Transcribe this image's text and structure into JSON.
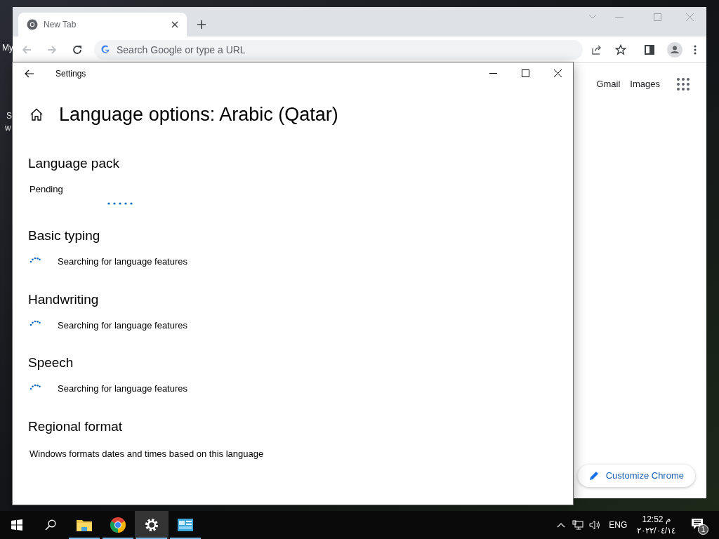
{
  "desktop_labels": [
    "My",
    "S",
    "w"
  ],
  "browser": {
    "tab": {
      "title": "New Tab",
      "selected": true
    },
    "address_placeholder": "Search Google or type a URL",
    "links": [
      "Gmail",
      "Images"
    ],
    "customize_button": "Customize Chrome"
  },
  "settings": {
    "window_title": "Settings",
    "heading": "Language options: Arabic (Qatar)",
    "sections": [
      {
        "kind": "progress",
        "title": "Language pack",
        "text": "Pending"
      },
      {
        "kind": "searching",
        "title": "Basic typing",
        "text": "Searching for language features"
      },
      {
        "kind": "searching",
        "title": "Handwriting",
        "text": "Searching for language features"
      },
      {
        "kind": "searching",
        "title": "Speech",
        "text": "Searching for language features"
      },
      {
        "kind": "plain",
        "title": "Regional format",
        "text": "Windows formats dates and times based on this language"
      }
    ]
  },
  "taskbar": {
    "apps": [
      {
        "kind": "explorer",
        "selected": false
      },
      {
        "kind": "chrome",
        "selected": false
      },
      {
        "kind": "settings",
        "selected": true
      },
      {
        "kind": "control",
        "selected": false
      }
    ],
    "language": "ENG",
    "time": "12:52 م",
    "date": "٢٠٢٢/٠٤/١٤",
    "notifications": "1"
  }
}
